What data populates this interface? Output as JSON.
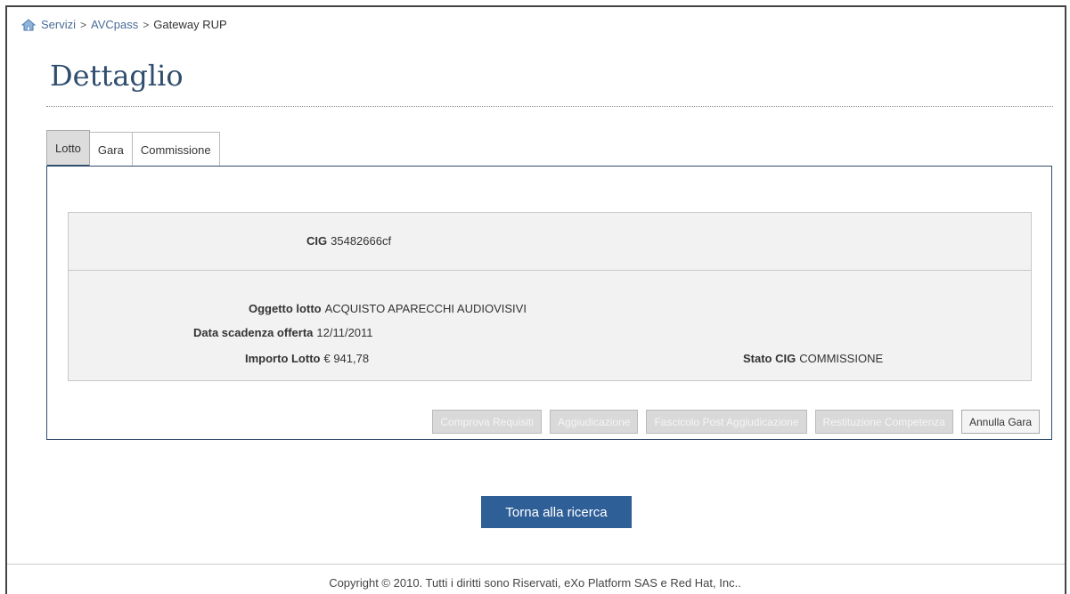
{
  "breadcrumb": {
    "home_icon": "home-icon",
    "items": [
      "Servizi",
      "AVCpass",
      "Gateway RUP"
    ],
    "separator": ">"
  },
  "page": {
    "title": "Dettaglio"
  },
  "tabs": [
    {
      "label": "Lotto",
      "active": true
    },
    {
      "label": "Gara",
      "active": false
    },
    {
      "label": "Commissione",
      "active": false
    }
  ],
  "lotto": {
    "cig_label": "CIG",
    "cig_value": "35482666cf",
    "oggetto_label": "Oggetto lotto",
    "oggetto_value": "ACQUISTO APARECCHI AUDIOVISIVI",
    "scadenza_label": "Data scadenza offerta",
    "scadenza_value": "12/11/2011",
    "importo_label": "Importo Lotto",
    "importo_value": "€ 941,78",
    "stato_label": "Stato CIG",
    "stato_value": "COMMISSIONE"
  },
  "actions": {
    "comprova": "Comprova Requisiti",
    "aggiudicazione": "Aggiudicazione",
    "fascicolo": "Fascicolo Post Aggiudicazione",
    "restituzione": "Restituzione Competenza",
    "annulla": "Annulla Gara"
  },
  "back_button": "Torna alla ricerca",
  "footer": "Copyright © 2010. Tutti i diritti sono Riservati, eXo Platform SAS e Red Hat, Inc..",
  "colors": {
    "accent": "#2f5f97",
    "title": "#2f4d6d"
  }
}
